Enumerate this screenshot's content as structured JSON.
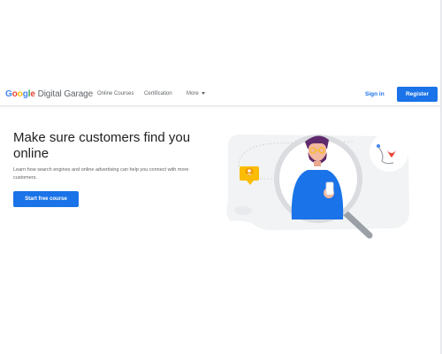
{
  "header": {
    "logo": {
      "brand": "Google",
      "product": " Digital Garage"
    },
    "nav": {
      "online_courses": "Online Courses",
      "certification": "Certification",
      "more": "More"
    },
    "sign_in": "Sign in",
    "register": "Register"
  },
  "hero": {
    "title": "Make sure customers find you online",
    "subtitle": "Learn how search engines and online advertising can help you connect with more customers.",
    "cta": "Start free course"
  },
  "colors": {
    "primary_blue": "#1a73e8",
    "google_blue": "#4285f4",
    "google_red": "#ea4335",
    "google_yellow": "#fbbc05",
    "google_green": "#34a853"
  }
}
